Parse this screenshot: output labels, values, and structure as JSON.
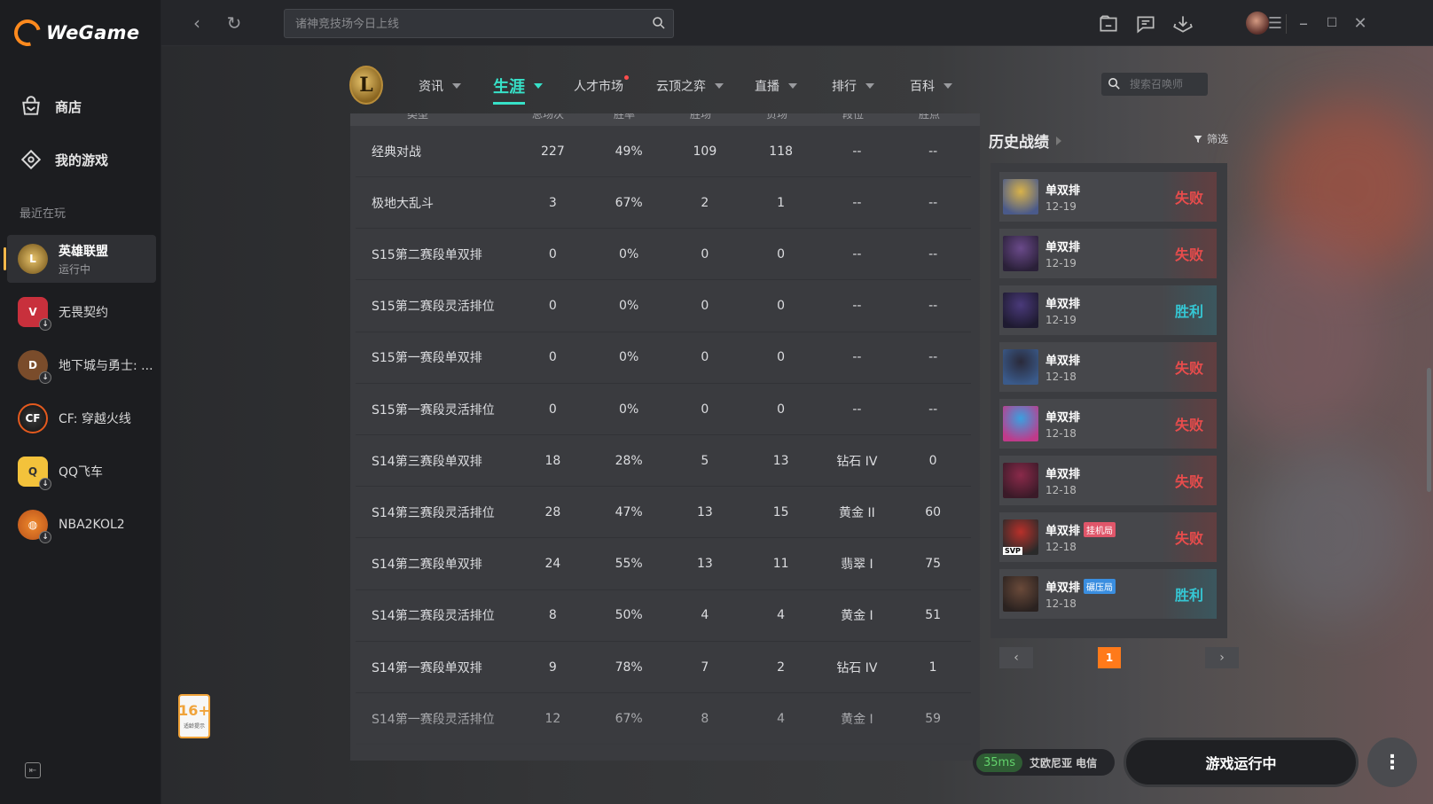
{
  "app": {
    "name": "WeGame"
  },
  "sidebar": {
    "nav": [
      {
        "label": "商店"
      },
      {
        "label": "我的游戏"
      }
    ],
    "recent_label": "最近在玩",
    "games": [
      {
        "name": "英雄联盟",
        "status": "运行中"
      },
      {
        "name": "无畏契约"
      },
      {
        "name": "地下城与勇士: ..."
      },
      {
        "name": "CF: 穿越火线"
      },
      {
        "name": "QQ飞车"
      },
      {
        "name": "NBA2KOL2"
      }
    ]
  },
  "topbar": {
    "search_placeholder": "诸神竞技场今日上线"
  },
  "lol_nav": {
    "tabs": [
      {
        "label": "资讯"
      },
      {
        "label": "生涯"
      },
      {
        "label": "人才市场"
      },
      {
        "label": "云顶之弈"
      },
      {
        "label": "直播"
      },
      {
        "label": "排行"
      },
      {
        "label": "百科"
      }
    ],
    "active_tab": "生涯",
    "summoner_placeholder": "搜索召唤师"
  },
  "stats_table": {
    "headers": [
      "类型",
      "总场次",
      "胜率",
      "胜场",
      "负场",
      "段位",
      "胜点"
    ],
    "rows": [
      [
        "经典对战",
        "227",
        "49%",
        "109",
        "118",
        "--",
        "--"
      ],
      [
        "极地大乱斗",
        "3",
        "67%",
        "2",
        "1",
        "--",
        "--"
      ],
      [
        "S15第二赛段单双排",
        "0",
        "0%",
        "0",
        "0",
        "--",
        "--"
      ],
      [
        "S15第二赛段灵活排位",
        "0",
        "0%",
        "0",
        "0",
        "--",
        "--"
      ],
      [
        "S15第一赛段单双排",
        "0",
        "0%",
        "0",
        "0",
        "--",
        "--"
      ],
      [
        "S15第一赛段灵活排位",
        "0",
        "0%",
        "0",
        "0",
        "--",
        "--"
      ],
      [
        "S14第三赛段单双排",
        "18",
        "28%",
        "5",
        "13",
        "钻石 IV",
        "0"
      ],
      [
        "S14第三赛段灵活排位",
        "28",
        "47%",
        "13",
        "15",
        "黄金 II",
        "60"
      ],
      [
        "S14第二赛段单双排",
        "24",
        "55%",
        "13",
        "11",
        "翡翠 I",
        "75"
      ],
      [
        "S14第二赛段灵活排位",
        "8",
        "50%",
        "4",
        "4",
        "黄金 I",
        "51"
      ],
      [
        "S14第一赛段单双排",
        "9",
        "78%",
        "7",
        "2",
        "钻石 IV",
        "1"
      ],
      [
        "S14第一赛段灵活排位",
        "12",
        "67%",
        "8",
        "4",
        "黄金 I",
        "59"
      ]
    ]
  },
  "history": {
    "title": "历史战绩",
    "filter_label": "筛选",
    "matches": [
      {
        "mode": "单双排",
        "date": "12-19",
        "result": "失败",
        "tag": ""
      },
      {
        "mode": "单双排",
        "date": "12-19",
        "result": "失败",
        "tag": ""
      },
      {
        "mode": "单双排",
        "date": "12-19",
        "result": "胜利",
        "tag": ""
      },
      {
        "mode": "单双排",
        "date": "12-18",
        "result": "失败",
        "tag": ""
      },
      {
        "mode": "单双排",
        "date": "12-18",
        "result": "失败",
        "tag": ""
      },
      {
        "mode": "单双排",
        "date": "12-18",
        "result": "失败",
        "tag": ""
      },
      {
        "mode": "单双排",
        "date": "12-18",
        "result": "失败",
        "tag": "挂机局"
      },
      {
        "mode": "单双排",
        "date": "12-18",
        "result": "胜利",
        "tag": "碾压局"
      }
    ],
    "page": "1",
    "champ_badge": "SVP"
  },
  "bottom": {
    "age_rating": "16+",
    "age_note": "适龄提示",
    "ping": "35ms",
    "server": "艾欧尼亚 电信",
    "run_label": "游戏运行中",
    "more_label": "⋮"
  },
  "colors": {
    "accent": "#37e1c8",
    "brand": "#ff8a1e",
    "lose": "#e84c4c",
    "win": "#35c6d3"
  }
}
